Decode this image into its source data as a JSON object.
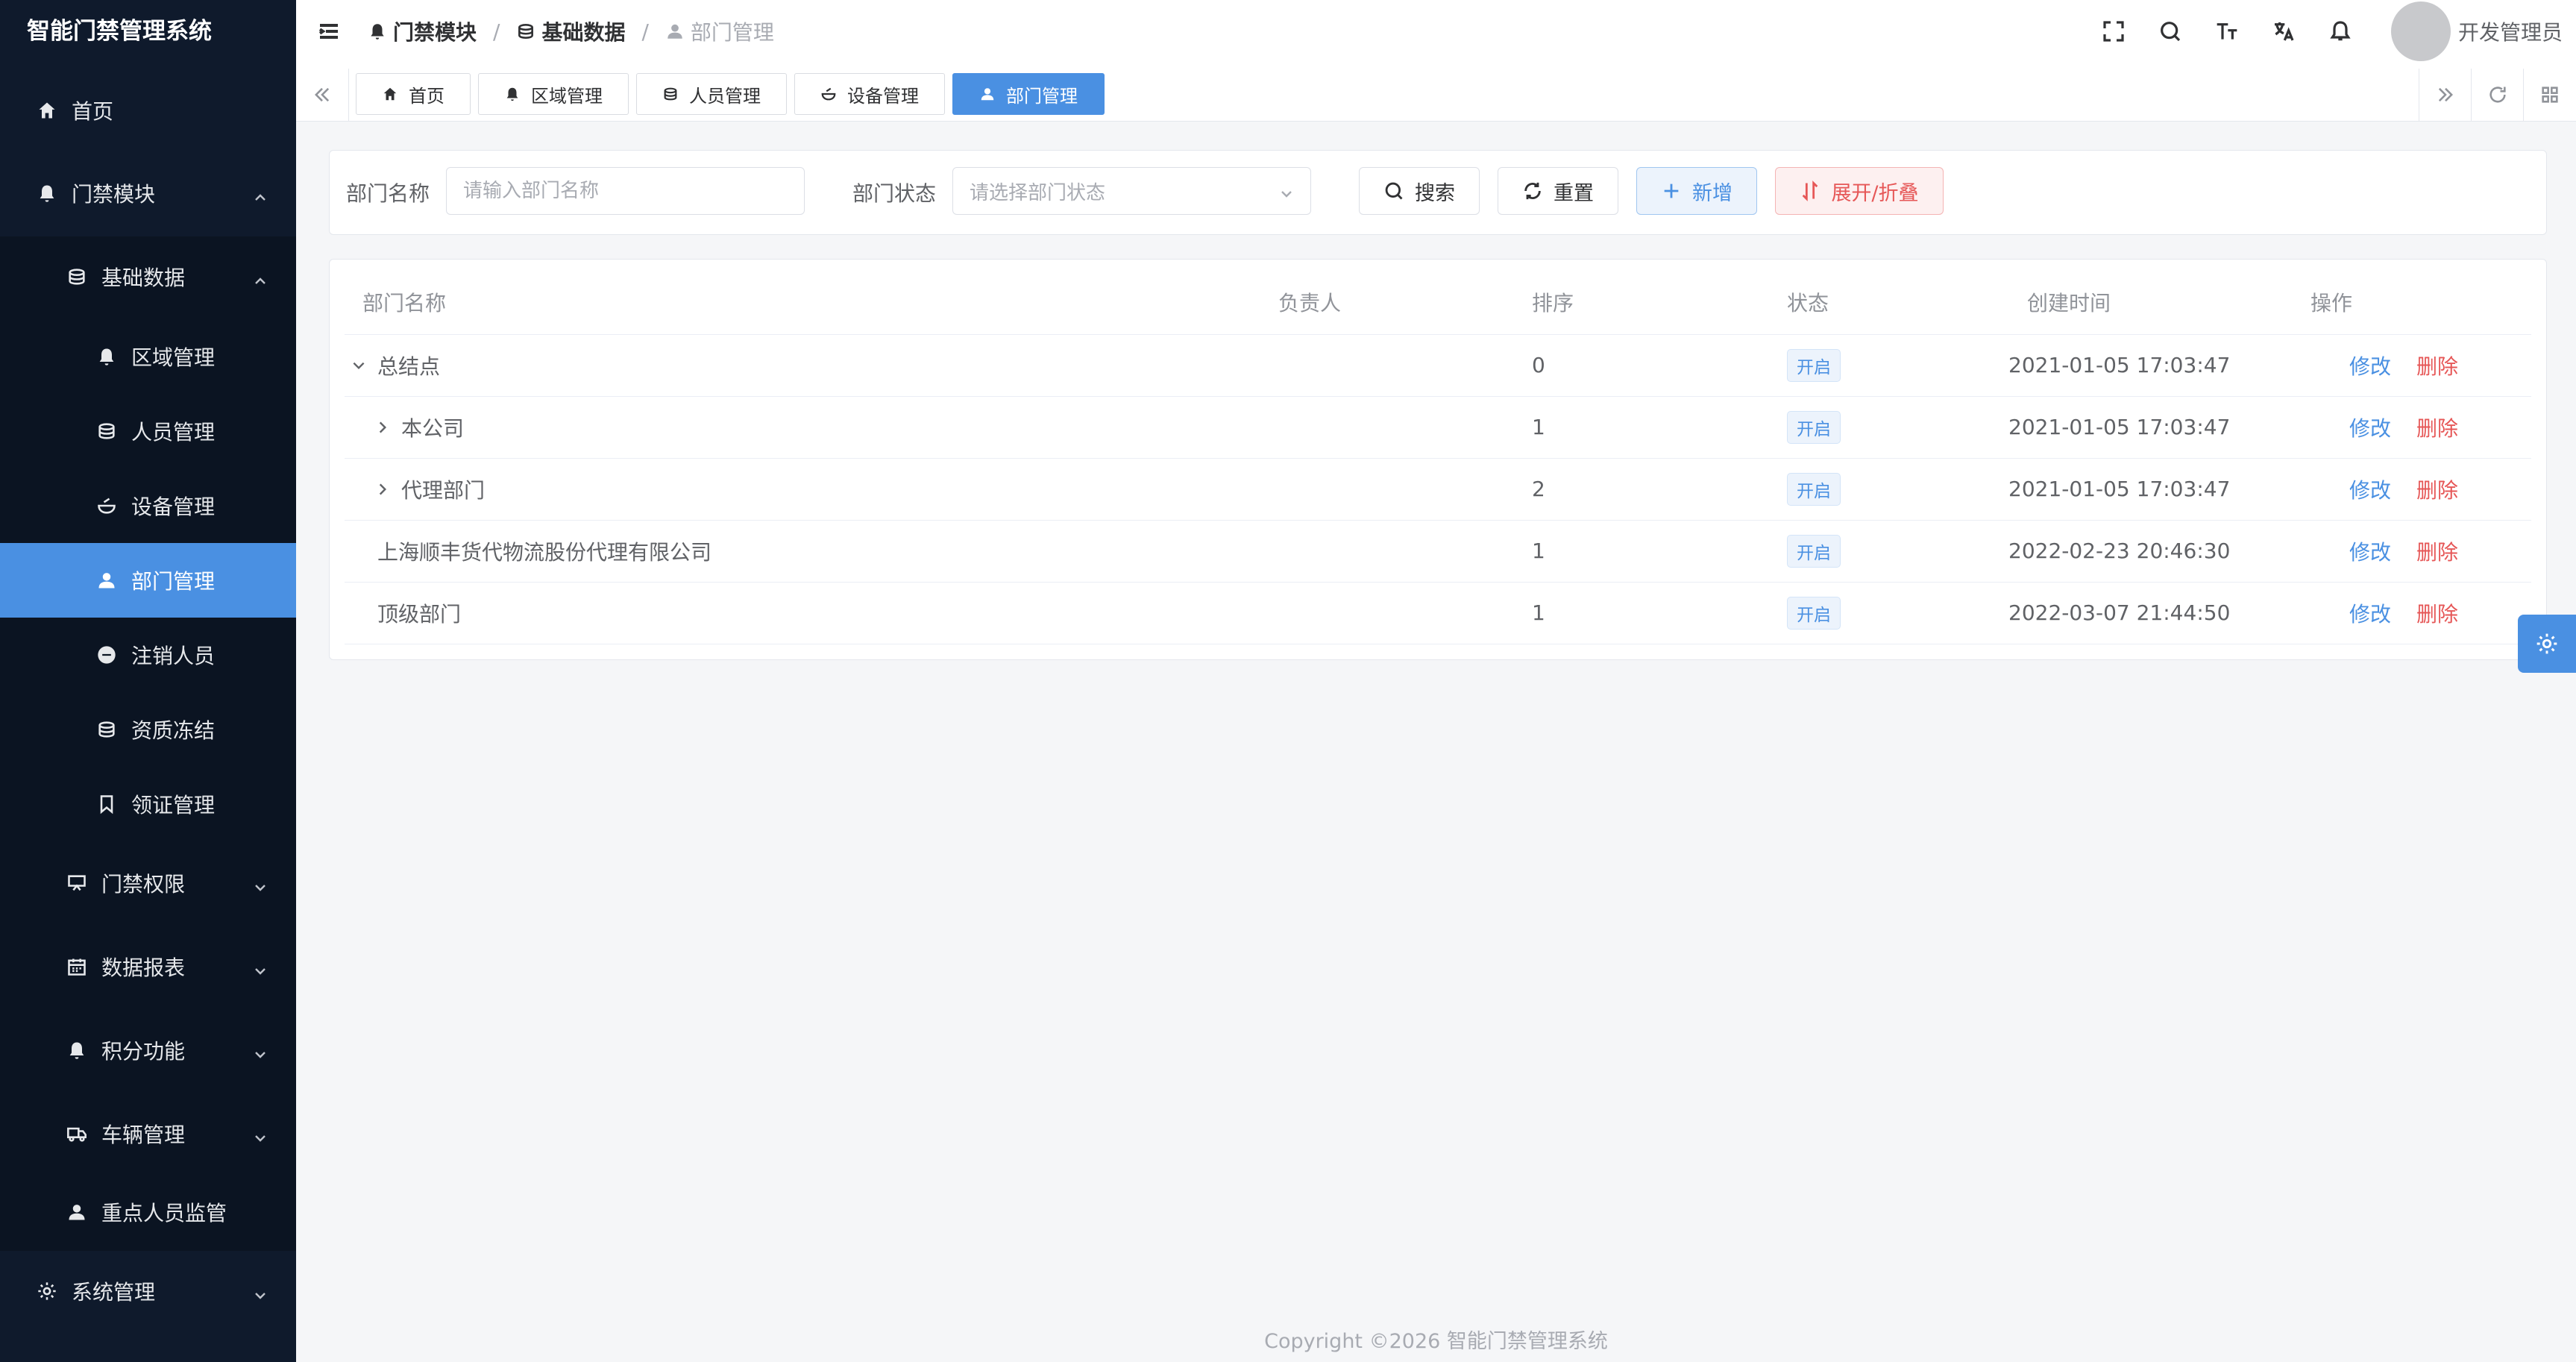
{
  "app": {
    "title": "智能门禁管理系统"
  },
  "sidebar": {
    "home": "首页",
    "access_module": "门禁模块",
    "basic_data": "基础数据",
    "area_mgmt": "区域管理",
    "person_mgmt": "人员管理",
    "device_mgmt": "设备管理",
    "dept_mgmt": "部门管理",
    "cancel_person": "注销人员",
    "qual_freeze": "资质冻结",
    "cert_mgmt": "领证管理",
    "access_perm": "门禁权限",
    "data_report": "数据报表",
    "points": "积分功能",
    "vehicle": "车辆管理",
    "key_person": "重点人员监管",
    "system": "系统管理"
  },
  "header": {
    "breadcrumb": [
      "门禁模块",
      "基础数据",
      "部门管理"
    ],
    "user_name": "开发管理员"
  },
  "tabs": [
    "首页",
    "区域管理",
    "人员管理",
    "设备管理",
    "部门管理"
  ],
  "search": {
    "dept_name_label": "部门名称",
    "dept_name_placeholder": "请输入部门名称",
    "dept_status_label": "部门状态",
    "dept_status_placeholder": "请选择部门状态",
    "search_btn": "搜索",
    "reset_btn": "重置",
    "add_btn": "新增",
    "expand_btn": "展开/折叠"
  },
  "table": {
    "columns": [
      "部门名称",
      "负责人",
      "排序",
      "状态",
      "创建时间",
      "操作"
    ],
    "edit_label": "修改",
    "delete_label": "删除",
    "rows": [
      {
        "name": "总结点",
        "leader": "",
        "order": "0",
        "status": "开启",
        "created": "2021-01-05 17:03:47"
      },
      {
        "name": "本公司",
        "leader": "",
        "order": "1",
        "status": "开启",
        "created": "2021-01-05 17:03:47"
      },
      {
        "name": "代理部门",
        "leader": "",
        "order": "2",
        "status": "开启",
        "created": "2021-01-05 17:03:47"
      },
      {
        "name": "上海顺丰货代物流股份代理有限公司",
        "leader": "",
        "order": "1",
        "status": "开启",
        "created": "2022-02-23 20:46:30"
      },
      {
        "name": "顶级部门",
        "leader": "",
        "order": "1",
        "status": "开启",
        "created": "2022-03-07 21:44:50"
      }
    ]
  },
  "footer": {
    "copyright": "Copyright ©2026 智能门禁管理系统"
  },
  "colors": {
    "sidebar_bg": "#0f1a2c",
    "accent": "#4a90e2",
    "danger": "#e65757"
  }
}
